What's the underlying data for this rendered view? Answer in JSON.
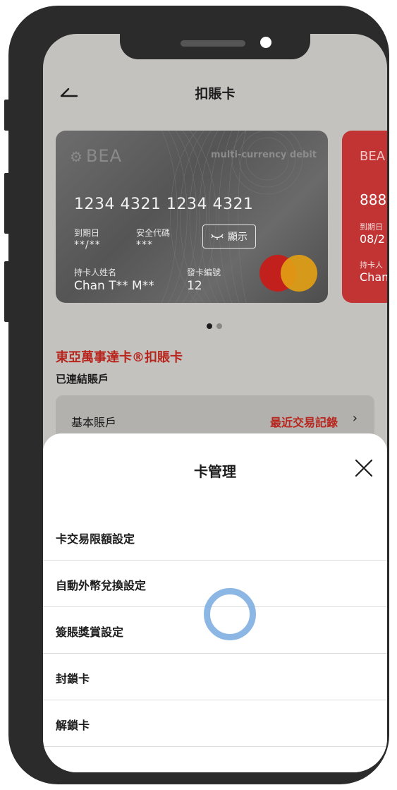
{
  "header": {
    "title": "扣賬卡"
  },
  "card": {
    "brand": "BEA",
    "type_label": "multi-currency debit",
    "number": "1234 4321 1234 4321",
    "expiry_label": "到期日",
    "expiry_value": "**/**",
    "cvv_label": "安全代碼",
    "cvv_value": "***",
    "show_label": "顯示",
    "holder_label": "持卡人姓名",
    "holder_name": "Chan T** M**",
    "seq_label": "發卡編號",
    "seq_value": "12"
  },
  "card2": {
    "brand": "BEA",
    "number": "888",
    "expiry_label": "到期日",
    "expiry_value": "08/2",
    "holder_label": "持卡人",
    "holder_value": "Chan"
  },
  "pagination": {
    "current": 1,
    "total": 2
  },
  "section": {
    "promo_title": "東亞萬事達卡®扣賬卡",
    "linked_label": "已連結賬戶"
  },
  "account": {
    "name": "基本賬戶",
    "recent_link": "最近交易記錄",
    "chevron": "›"
  },
  "sheet": {
    "title": "卡管理",
    "items": [
      "卡交易限額設定",
      "自動外幣兌換設定",
      "簽賬獎賞設定",
      "封鎖卡",
      "解鎖卡"
    ]
  },
  "colors": {
    "accent_red": "#b8251d",
    "card2_red": "#c23434",
    "touch_indicator": "#78aae1"
  },
  "icons": {
    "back": "back-arrow-icon",
    "close": "close-icon",
    "eye": "eye-closed-icon",
    "mastercard": "mastercard-logo"
  }
}
